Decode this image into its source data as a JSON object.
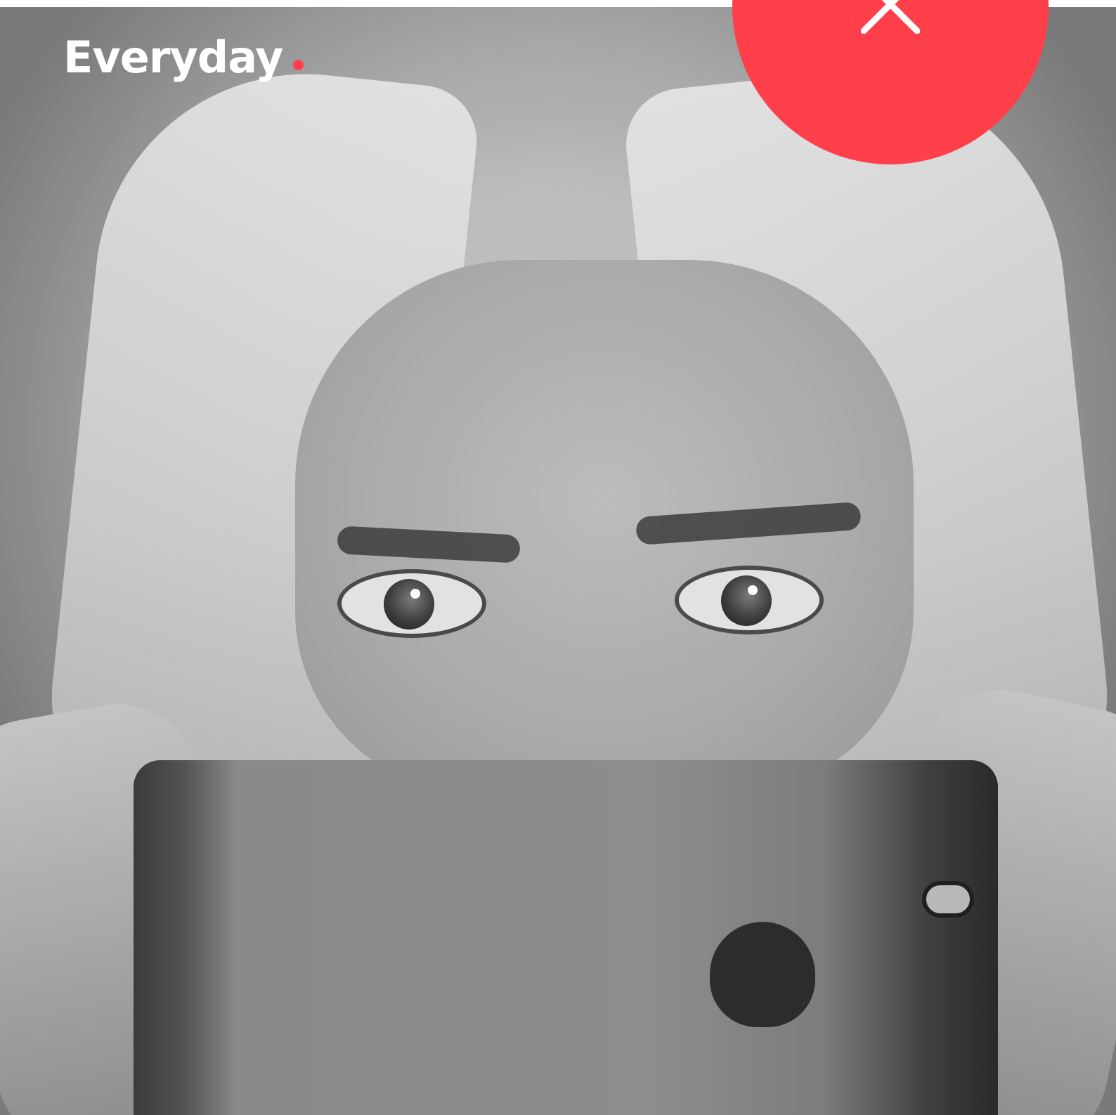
{
  "brand": {
    "name": "Everyday"
  },
  "colors": {
    "accent": "#ff3f4a",
    "brand_text": "#ffffff"
  },
  "close_button": {
    "icon": "close-icon"
  },
  "hero": {
    "style": "grayscale"
  }
}
